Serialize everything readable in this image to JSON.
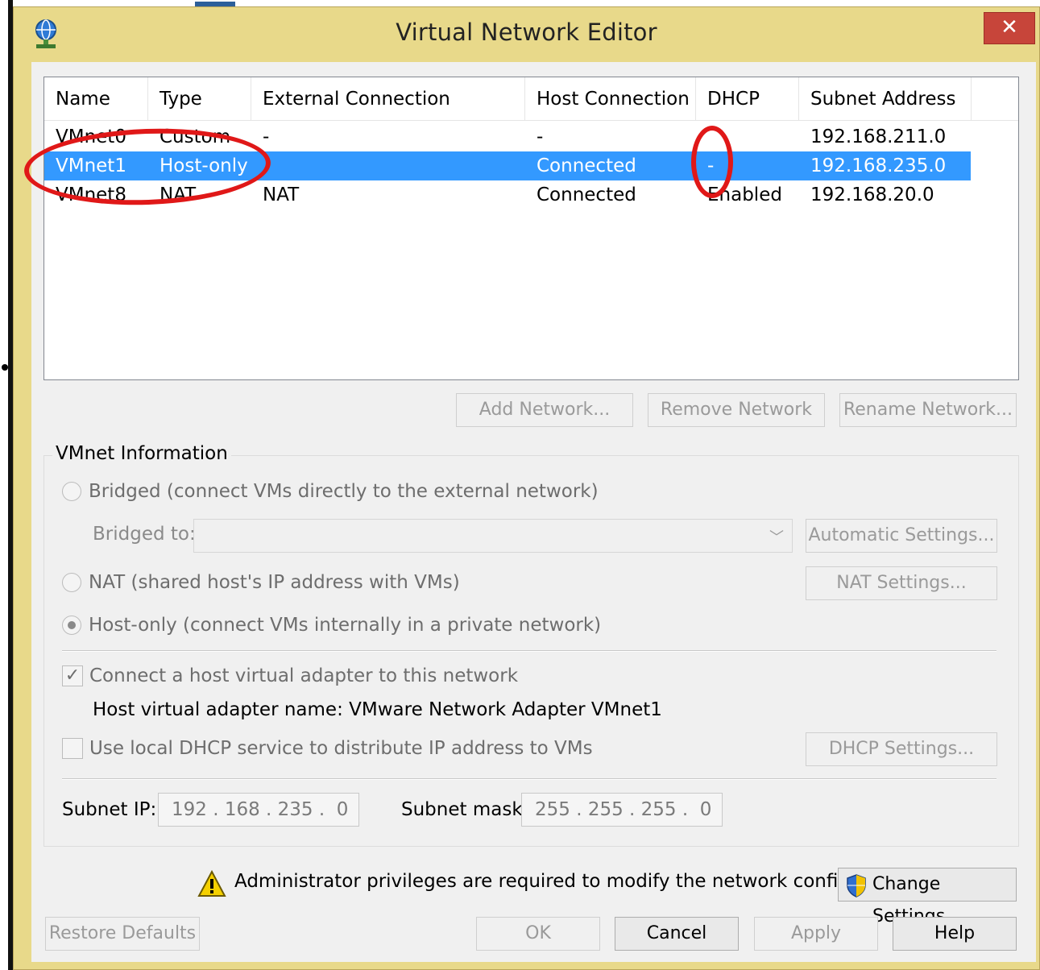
{
  "window": {
    "title": "Virtual Network Editor",
    "close_label": "✕"
  },
  "table": {
    "columns": [
      "Name",
      "Type",
      "External Connection",
      "Host Connection",
      "DHCP",
      "Subnet Address"
    ],
    "rows": [
      {
        "name": "VMnet0",
        "type": "Custom",
        "external": "-",
        "host": "-",
        "dhcp": "",
        "subnet": "192.168.211.0"
      },
      {
        "name": "VMnet1",
        "type": "Host-only",
        "external": "",
        "host": "Connected",
        "dhcp": "-",
        "subnet": "192.168.235.0"
      },
      {
        "name": "VMnet8",
        "type": "NAT",
        "external": "NAT",
        "host": "Connected",
        "dhcp": "Enabled",
        "subnet": "192.168.20.0"
      }
    ],
    "selected_row": 1
  },
  "network_buttons": {
    "add": "Add Network...",
    "remove": "Remove Network",
    "rename": "Rename Network..."
  },
  "vmnet_info": {
    "legend": "VMnet Information",
    "bridged_label": "Bridged (connect VMs directly to the external network)",
    "bridged_to_label": "Bridged to:",
    "bridged_to_value": "",
    "automatic_settings": "Automatic Settings...",
    "nat_label": "NAT (shared host's IP address with VMs)",
    "nat_settings": "NAT Settings...",
    "hostonly_label": "Host-only (connect VMs internally in a private network)",
    "connect_adapter_label": "Connect a host virtual adapter to this network",
    "connect_adapter_checked": true,
    "adapter_name_text": "Host virtual adapter name: VMware Network Adapter VMnet1",
    "dhcp_label": "Use local DHCP service to distribute IP address to VMs",
    "dhcp_checked": false,
    "dhcp_settings": "DHCP Settings...",
    "subnet_ip_label": "Subnet IP:",
    "subnet_ip_value": "192 . 168 . 235 .  0",
    "subnet_mask_label": "Subnet mask:",
    "subnet_mask_value": "255 . 255 . 255 .  0",
    "selected_mode": "host-only"
  },
  "admin": {
    "warning_text": "Administrator privileges are required to modify the network configuration.",
    "change_settings": "Change Settings"
  },
  "footer": {
    "restore_defaults": "Restore Defaults",
    "ok": "OK",
    "cancel": "Cancel",
    "apply": "Apply",
    "help": "Help"
  },
  "colors": {
    "titlebar": "#e8d98a",
    "selection": "#3399ff",
    "close_button": "#c7453a",
    "annotation": "#e01818"
  },
  "icons": {
    "app": "network-globe-icon",
    "close": "close-icon",
    "dropdown": "chevron-down-icon",
    "warning": "warning-icon",
    "shield": "shield-icon"
  }
}
